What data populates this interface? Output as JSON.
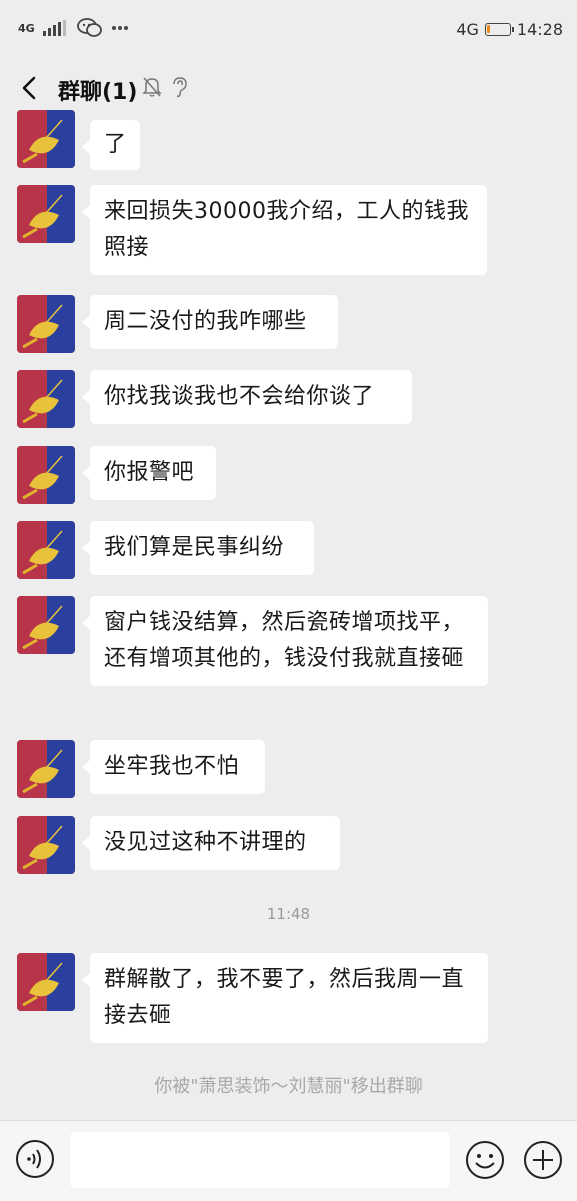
{
  "status_bar": {
    "left_network": "4G",
    "right_network": "4G",
    "time": "14:28",
    "battery_level": 0.15
  },
  "header": {
    "back_icon": "chevron-left-icon",
    "title": "群聊(1)",
    "mute_icon": "bell-off-icon",
    "ear_icon": "ear-icon"
  },
  "messages": [
    {
      "text": "了"
    },
    {
      "text": "来回损失30000我介绍，工人的钱我照接"
    },
    {
      "text": "周二没付的我咋哪些"
    },
    {
      "text": "你找我谈我也不会给你谈了"
    },
    {
      "text": "你报警吧"
    },
    {
      "text": "我们算是民事纠纷"
    },
    {
      "text": "窗户钱没结算，然后瓷砖增项找平，还有增项其他的，钱没付我就直接砸"
    },
    {
      "text": "坐牢我也不怕"
    },
    {
      "text": "没见过这种不讲理的"
    },
    {
      "text": "群解散了，我不要了，然后我周一直接去砸"
    }
  ],
  "timestamp": "11:48",
  "system_notice": "你被\"萧思装饰～刘慧丽\"移出群聊",
  "bottom_bar": {
    "voice_icon": "voice-icon",
    "input_value": "",
    "emoji_icon": "emoji-icon",
    "plus_icon": "plus-icon"
  },
  "colors": {
    "background": "#ededed",
    "bubble": "#ffffff",
    "battery": "#f08a1c"
  }
}
